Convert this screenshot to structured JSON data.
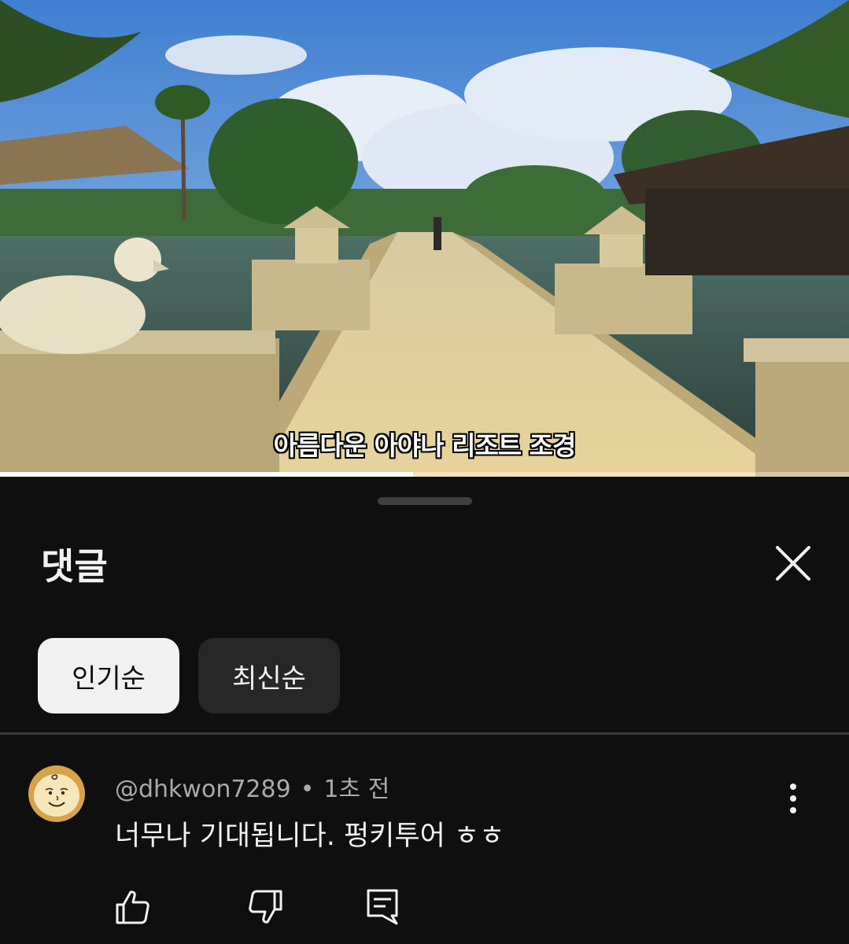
{
  "video": {
    "subtitle": "아름다운 아야나 리조트 조경",
    "progress": 0.487
  },
  "comments_panel": {
    "title": "댓글",
    "sort_chips": [
      {
        "label": "인기순",
        "selected": true
      },
      {
        "label": "최신순",
        "selected": false
      }
    ],
    "comments": [
      {
        "author": "@dhkwon7289",
        "time": "1초 전",
        "text": "너무나 기대됩니다. 펑키투어 ㅎㅎ",
        "avatar_icon": "charlie-brown-avatar"
      }
    ]
  },
  "icons": {
    "close": "close-icon",
    "more": "more-vert-icon",
    "like": "thumb-up-icon",
    "dislike": "thumb-down-icon",
    "reply": "reply-comment-icon"
  },
  "colors": {
    "background": "#0f0f0f",
    "chip_selected_bg": "#f1f1f1",
    "chip_bg": "#272727",
    "text_primary": "#f1f1f1",
    "text_secondary": "#aaaaaa"
  }
}
